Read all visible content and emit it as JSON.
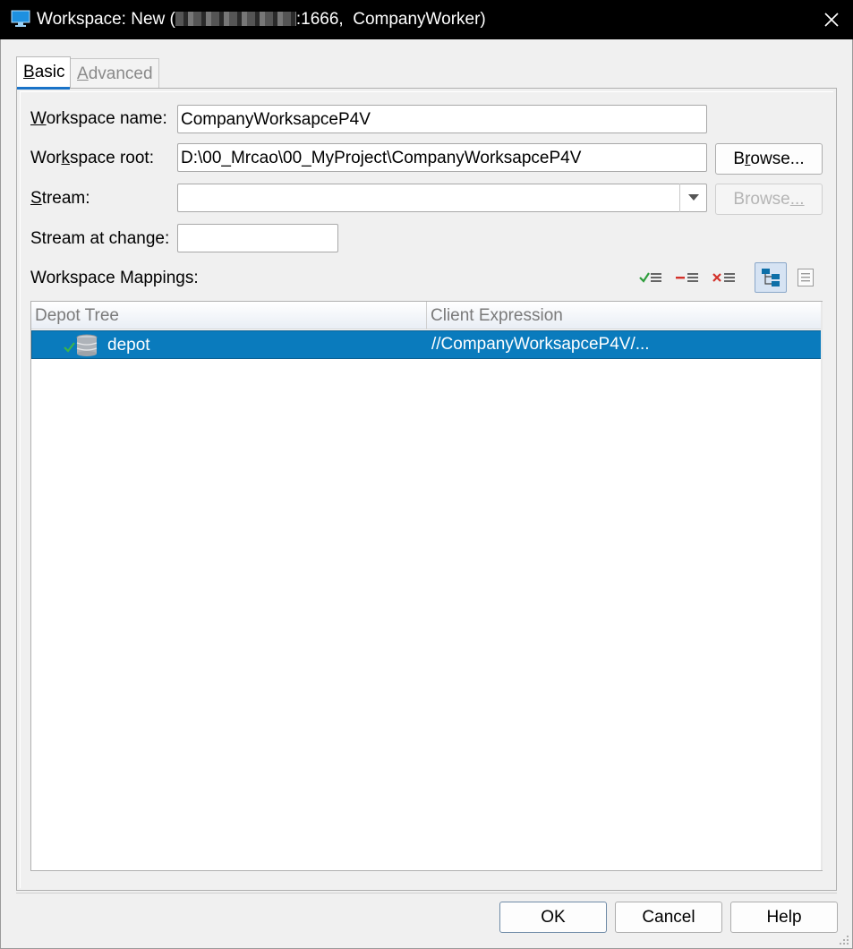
{
  "window": {
    "title_prefix": "Workspace: New (",
    "title_suffix": ":1666,  CompanyWorker)",
    "close_label": "Close"
  },
  "tabs": {
    "basic": {
      "pre": "",
      "ul": "B",
      "post": "asic"
    },
    "advanced": {
      "pre": "",
      "ul": "A",
      "post": "dvanced"
    }
  },
  "form": {
    "workspace_name": {
      "label_pre": "",
      "label_ul": "W",
      "label_post": "orkspace name:",
      "value": "CompanyWorksapceP4V"
    },
    "workspace_root": {
      "label_pre": "Wor",
      "label_ul": "k",
      "label_post": "space root:",
      "value": "D:\\00_Mrcao\\00_MyProject\\CompanyWorksapceP4V"
    },
    "stream": {
      "label_pre": "",
      "label_ul": "S",
      "label_post": "tream:",
      "value": ""
    },
    "stream_at_change": {
      "label": "Stream at change:",
      "value": ""
    },
    "browse_root": {
      "pre": "B",
      "ul": "r",
      "post": "owse..."
    },
    "browse_stream": {
      "pre": "Browse",
      "ul": "...",
      "post": ""
    }
  },
  "mappings": {
    "label": "Workspace Mappings:",
    "columns": [
      "Depot Tree",
      "Client Expression"
    ],
    "rows": [
      {
        "depot": "depot",
        "client": "//CompanyWorksapceP4V/..."
      }
    ]
  },
  "footer": {
    "ok": "OK",
    "cancel": "Cancel",
    "help": "Help"
  },
  "colors": {
    "selection": "#0a7bbd",
    "tab_accent": "#1a73c8"
  }
}
